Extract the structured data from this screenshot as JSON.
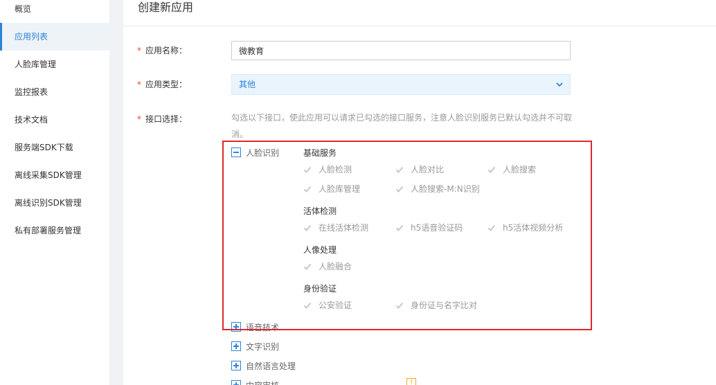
{
  "sidebar": {
    "items": [
      {
        "label": "概览",
        "active": false
      },
      {
        "label": "应用列表",
        "active": true
      },
      {
        "label": "人脸库管理",
        "active": false
      },
      {
        "label": "监控报表",
        "active": false
      },
      {
        "label": "技术文档",
        "active": false
      },
      {
        "label": "服务端SDK下载",
        "active": false
      },
      {
        "label": "离线采集SDK管理",
        "active": false
      },
      {
        "label": "离线识别SDK管理",
        "active": false
      },
      {
        "label": "私有部署服务管理",
        "active": false
      }
    ]
  },
  "page": {
    "title": "创建新应用"
  },
  "form": {
    "required_mark": "*",
    "app_name": {
      "label": "应用名称：",
      "value": "微教育"
    },
    "app_type": {
      "label": "应用类型：",
      "value": "其他"
    },
    "api_select": {
      "label": "接口选择：",
      "hint": "勾选以下接口，使此应用可以请求已勾选的接口服务，注意人脸识别服务已默认勾选并不可取消。"
    }
  },
  "tree": {
    "face": {
      "label": "人脸识别",
      "expanded": true,
      "groups": [
        {
          "title": "基础服务",
          "items": [
            "人脸检测",
            "人脸对比",
            "人脸搜索",
            "人脸库管理",
            "人脸搜索-M:N识别"
          ]
        },
        {
          "title": "活体检测",
          "items": [
            "在线活体检测",
            "h5语音验证码",
            "h5活体视频分析"
          ]
        },
        {
          "title": "人像处理",
          "items": [
            "人脸融合"
          ]
        },
        {
          "title": "身份验证",
          "items": [
            "公安验证",
            "身份证与名字比对"
          ]
        }
      ]
    },
    "collapsed": [
      {
        "label": "语音技术"
      },
      {
        "label": "文字识别"
      },
      {
        "label": "自然语言处理"
      },
      {
        "label": "内容审核"
      }
    ]
  },
  "colors": {
    "accent": "#2b82d9",
    "highlight": "#e0262a",
    "checkbox_disabled": "#c8c8c8"
  }
}
